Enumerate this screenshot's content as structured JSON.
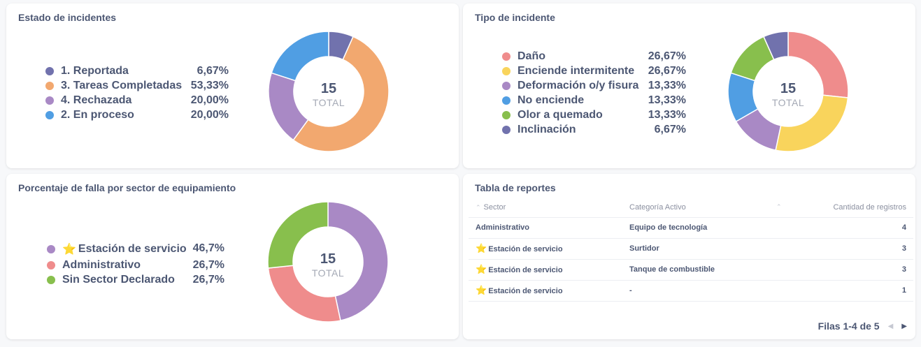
{
  "estado": {
    "title": "Estado de incidentes",
    "total": "15",
    "total_label": "TOTAL",
    "items": [
      {
        "label": "1. Reportada",
        "value": "6,67%",
        "pct": 6.67,
        "color": "#7172ad"
      },
      {
        "label": "3. Tareas Completadas",
        "value": "53,33%",
        "pct": 53.33,
        "color": "#f2a86f"
      },
      {
        "label": "4. Rechazada",
        "value": "20,00%",
        "pct": 20.0,
        "color": "#a989c5"
      },
      {
        "label": "2. En proceso",
        "value": "20,00%",
        "pct": 20.0,
        "color": "#509ee3"
      }
    ]
  },
  "tipo": {
    "title": "Tipo de incidente",
    "total": "15",
    "total_label": "TOTAL",
    "items": [
      {
        "label": "Daño",
        "value": "26,67%",
        "pct": 26.67,
        "color": "#ef8c8c"
      },
      {
        "label": "Enciende intermitente",
        "value": "26,67%",
        "pct": 26.67,
        "color": "#f9d45c"
      },
      {
        "label": "Deformación o/y fisura",
        "value": "13,33%",
        "pct": 13.33,
        "color": "#a989c5"
      },
      {
        "label": "No enciende",
        "value": "13,33%",
        "pct": 13.33,
        "color": "#509ee3"
      },
      {
        "label": "Olor a quemado",
        "value": "13,33%",
        "pct": 13.33,
        "color": "#88bf4d"
      },
      {
        "label": "Inclinación",
        "value": "6,67%",
        "pct": 6.67,
        "color": "#7172ad"
      }
    ]
  },
  "sector": {
    "title": "Porcentaje de falla por sector de equipamiento",
    "total": "15",
    "total_label": "TOTAL",
    "items": [
      {
        "label": "Estación de servicio",
        "value": "46,7%",
        "pct": 46.7,
        "color": "#a989c5",
        "star": true
      },
      {
        "label": "Administrativo",
        "value": "26,7%",
        "pct": 26.7,
        "color": "#ef8c8c"
      },
      {
        "label": "Sin Sector Declarado",
        "value": "26,7%",
        "pct": 26.7,
        "color": "#88bf4d"
      }
    ]
  },
  "tabla": {
    "title": "Tabla de reportes",
    "columns": [
      "Sector",
      "Categoría Activo",
      "Cantidad de registros"
    ],
    "rows": [
      {
        "sector": "Administrativo",
        "categoria": "Equipo de tecnología",
        "cantidad": "4",
        "star": false
      },
      {
        "sector": "Estación de servicio",
        "categoria": "Surtidor",
        "cantidad": "3",
        "star": true
      },
      {
        "sector": "Estación de servicio",
        "categoria": "Tanque de combustible",
        "cantidad": "3",
        "star": true
      },
      {
        "sector": "Estación de servicio",
        "categoria": "-",
        "cantidad": "1",
        "star": true
      }
    ],
    "pagination": "Filas 1-4 de 5"
  },
  "icons": {
    "star": "star-icon",
    "prev": "chevron-left-icon",
    "next": "chevron-right-icon",
    "sort": "sort-arrow-icon"
  }
}
